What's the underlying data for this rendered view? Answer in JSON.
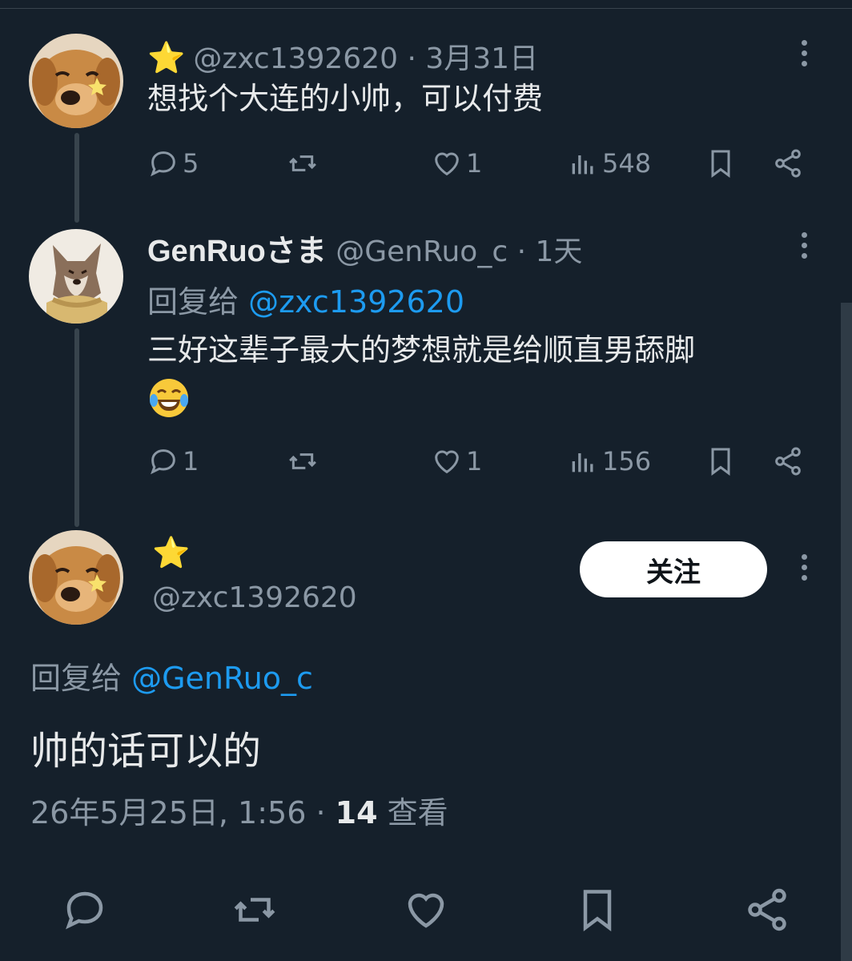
{
  "thread": [
    {
      "star": "⭐",
      "handle": "@zxc1392620",
      "time": "3月31日",
      "text": "想找个大连的小帅，可以付费",
      "stats": {
        "replies": "5",
        "likes": "1",
        "views": "548"
      }
    },
    {
      "name": "GenRuoさま",
      "handle": "@GenRuo_c",
      "time": "1天",
      "reply_label": "回复给",
      "reply_mention": "@zxc1392620",
      "text": "三好这辈子最大的梦想就是给顺直男舔脚",
      "stats": {
        "replies": "1",
        "likes": "1",
        "views": "156"
      }
    }
  ],
  "focused": {
    "star": "⭐",
    "handle": "@zxc1392620",
    "follow_label": "关注",
    "reply_label": "回复给",
    "reply_mention": "@GenRuo_c",
    "text": "帅的话可以的",
    "timestamp": "26年5月25日, 1:56",
    "views_count": "14",
    "views_label": "查看"
  },
  "icons": [
    "reply-icon",
    "retweet-icon",
    "like-icon",
    "views-icon",
    "bookmark-icon",
    "share-icon",
    "more-icon",
    "laughing-emoji"
  ],
  "colors": {
    "background": "#15202b",
    "text": "#e7e9ea",
    "muted": "#8b98a5",
    "link": "#1d9bf0",
    "thread_line": "#38444d"
  }
}
